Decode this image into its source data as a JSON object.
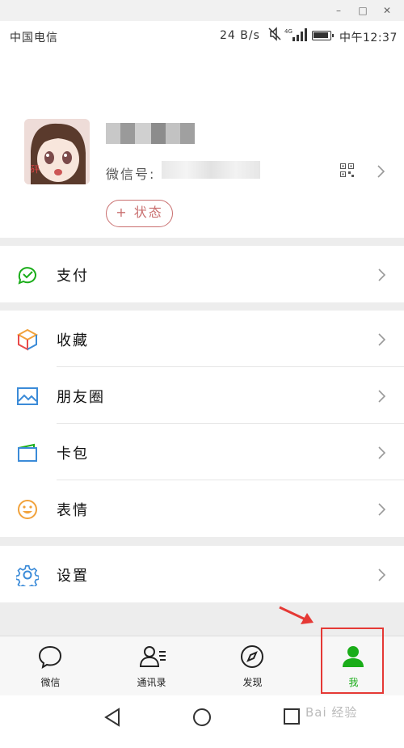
{
  "status_bar": {
    "carrier": "中国电信",
    "net_speed": "24 B/s",
    "time": "中午12:37",
    "signal_type": "4G"
  },
  "profile": {
    "wechat_id_label": "微信号:",
    "status_button": "+ 状态"
  },
  "menu": {
    "payment": "支付",
    "favorites": "收藏",
    "moments": "朋友圈",
    "cards": "卡包",
    "stickers": "表情",
    "settings": "设置"
  },
  "tabs": {
    "chats": "微信",
    "contacts": "通讯录",
    "discover": "发现",
    "me": "我"
  },
  "watermark": "Bai 经验",
  "colors": {
    "accent_green": "#1aad19",
    "highlight_red": "#e53935",
    "status_pink": "#c96f6f"
  }
}
